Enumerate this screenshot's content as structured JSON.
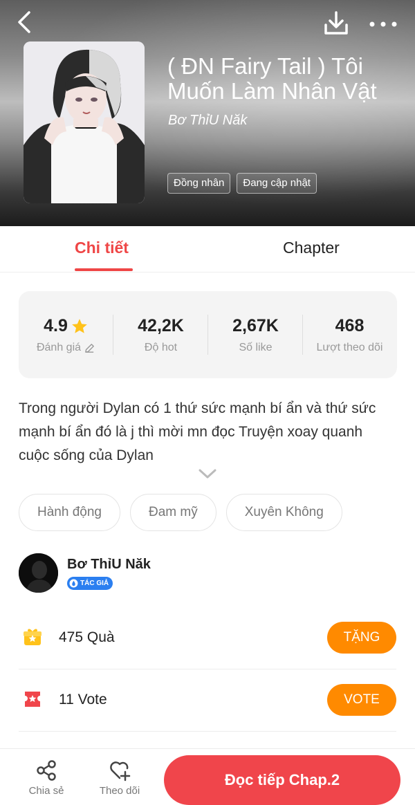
{
  "header": {
    "title": "( ĐN Fairy Tail ) Tôi Muốn Làm Nhân Vật",
    "author": "Bơ ThỉU Năk",
    "tags": [
      "Đồng nhân",
      "Đang cập nhật"
    ],
    "icons": [
      "back-arrow",
      "download",
      "more-horizontal"
    ]
  },
  "tabs": [
    {
      "label": "Chi tiết",
      "active": true
    },
    {
      "label": "Chapter",
      "active": false
    }
  ],
  "stats": {
    "rating": {
      "value": "4.9",
      "label": "Đánh giá"
    },
    "hot": {
      "value": "42,2K",
      "label": "Độ hot"
    },
    "likes": {
      "value": "2,67K",
      "label": "Số like"
    },
    "followers": {
      "value": "468",
      "label": "Lượt theo dõi"
    }
  },
  "description": "Trong người Dylan có 1 thứ sức mạnh bí ẩn và thứ sức mạnh bí ẩn đó là j thì mời mn đọc Truyện xoay quanh cuộc sống của Dylan",
  "genres": [
    "Hành động",
    "Đam mỹ",
    "Xuyên Không"
  ],
  "author_card": {
    "name": "Bơ ThỉU Năk",
    "badge": "TÁC GIẢ"
  },
  "gift": {
    "text": "475  Quà",
    "button": "TẶNG"
  },
  "vote": {
    "text": "11  Vote",
    "button": "VOTE"
  },
  "bottom_bar": {
    "share_label": "Chia sẻ",
    "follow_label": "Theo dõi",
    "read_button": "Đọc tiếp Chap.2"
  },
  "colors": {
    "accent": "#ef4646",
    "orange": "#ff8a00",
    "read": "#f0454b",
    "badge": "#2b7ff0"
  }
}
